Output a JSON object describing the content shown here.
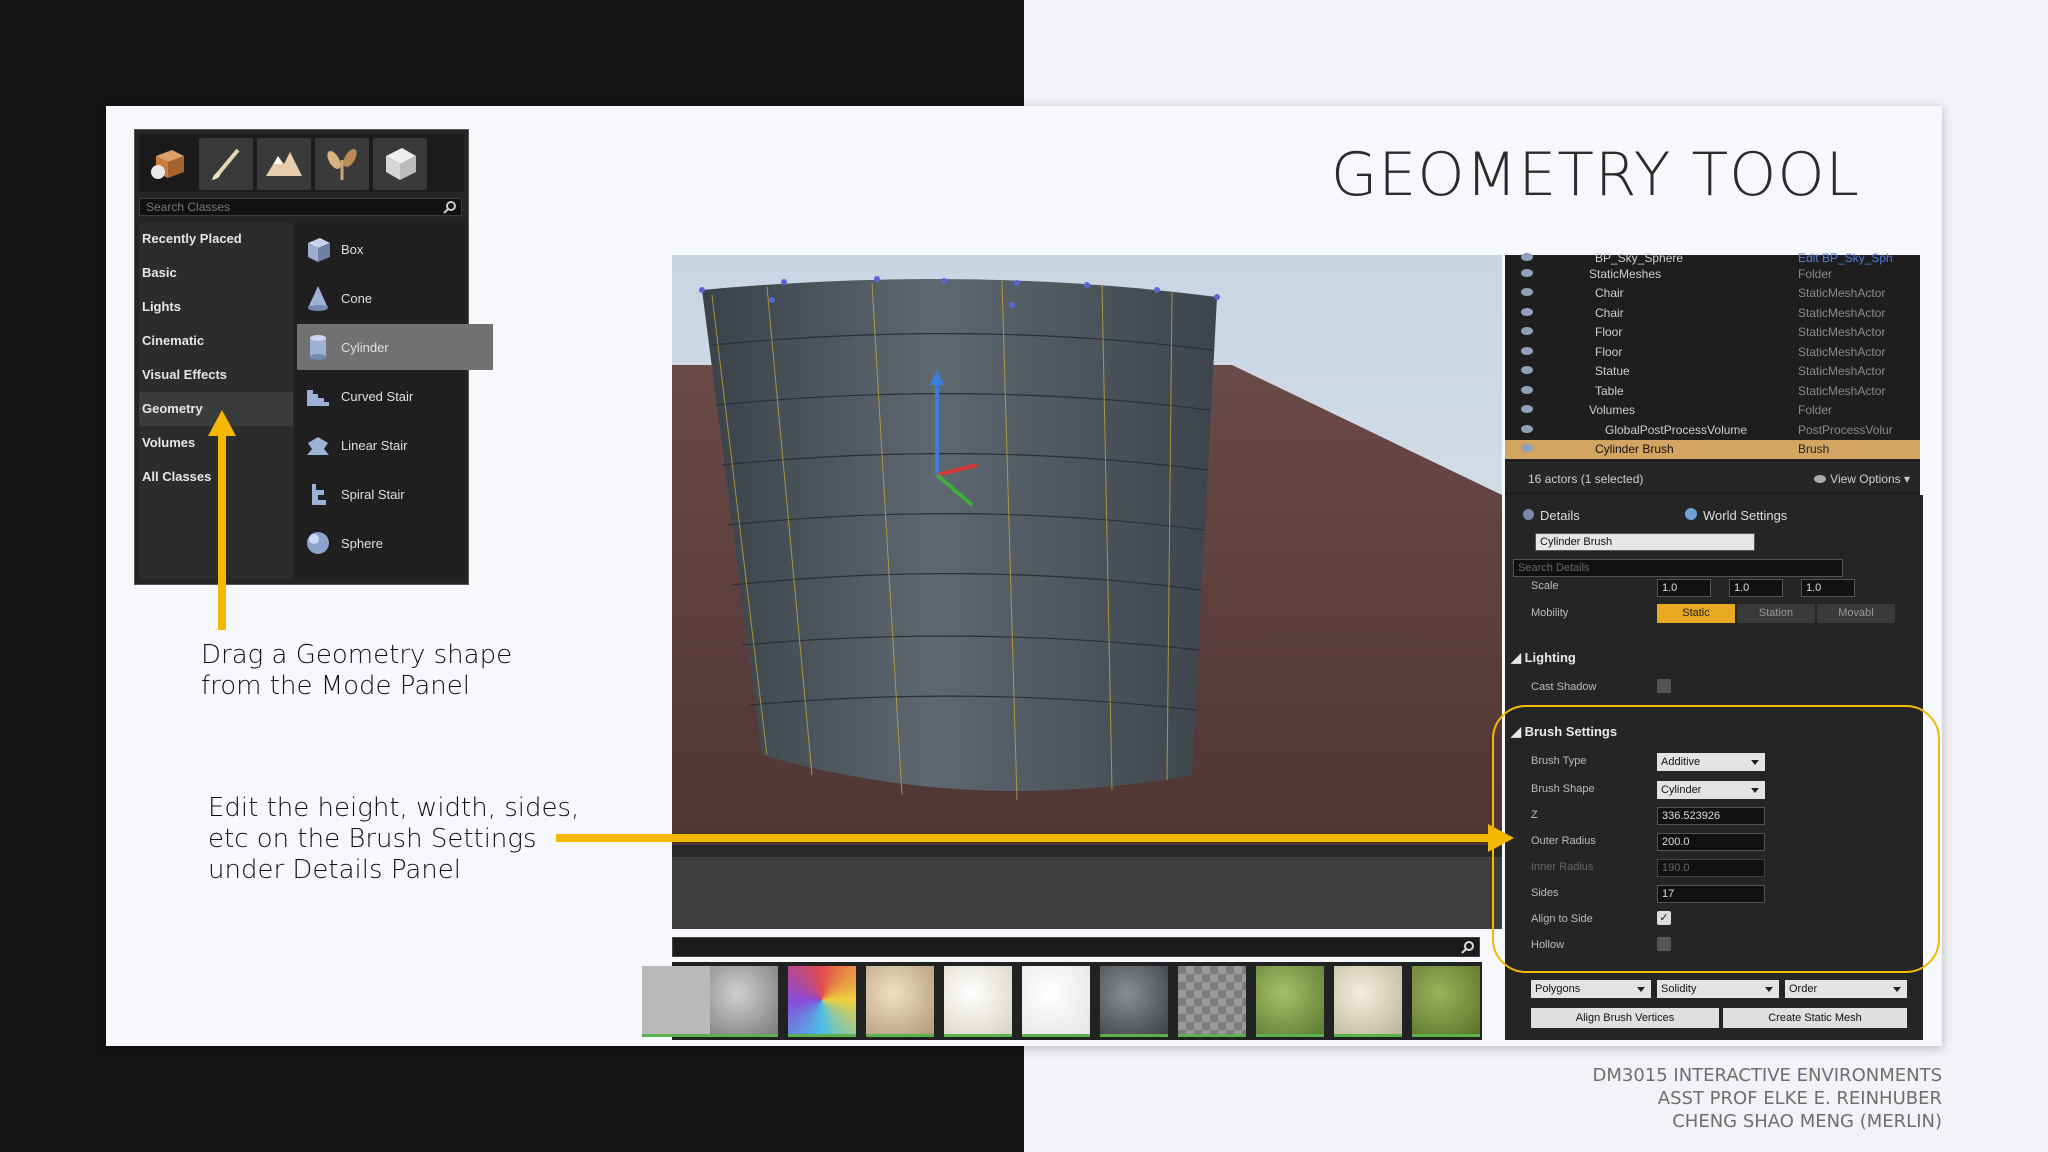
{
  "slide": {
    "title": "GEOMETRY TOOL",
    "callout_drag": [
      "Drag a Geometry shape",
      "from the Mode Panel"
    ],
    "callout_edit": [
      "Edit the height, width, sides,",
      "etc on the Brush Settings",
      "under Details Panel"
    ],
    "footer": [
      "DM3015 INTERACTIVE ENVIRONMENTS",
      "ASST PROF ELKE E. REINHUBER",
      "CHENG SHAO MENG (MERLIN)"
    ],
    "accent_color": "#f5b800"
  },
  "mode_panel": {
    "search_placeholder": "Search Classes",
    "tabs": [
      "place-icon",
      "paint-icon",
      "landscape-icon",
      "foliage-icon",
      "geometry-edit-icon"
    ],
    "categories": [
      "Recently Placed",
      "Basic",
      "Lights",
      "Cinematic",
      "Visual Effects",
      "Geometry",
      "Volumes",
      "All Classes"
    ],
    "active_category": "Geometry",
    "items": [
      "Box",
      "Cone",
      "Cylinder",
      "Curved Stair",
      "Linear Stair",
      "Spiral Stair",
      "Sphere"
    ],
    "selected_item": "Cylinder"
  },
  "outliner": {
    "top_partial": {
      "name": "BP_Sky_Sphere",
      "type": "Edit BP_Sky_Sph"
    },
    "rows": [
      {
        "name": "StaticMeshes",
        "type": "Folder"
      },
      {
        "name": "Chair",
        "type": "StaticMeshActor"
      },
      {
        "name": "Chair",
        "type": "StaticMeshActor"
      },
      {
        "name": "Floor",
        "type": "StaticMeshActor"
      },
      {
        "name": "Floor",
        "type": "StaticMeshActor"
      },
      {
        "name": "Statue",
        "type": "StaticMeshActor"
      },
      {
        "name": "Table",
        "type": "StaticMeshActor"
      },
      {
        "name": "Volumes",
        "type": "Folder"
      },
      {
        "name": "GlobalPostProcessVolume",
        "type": "PostProcessVolur"
      },
      {
        "name": "Cylinder Brush",
        "type": "Brush"
      }
    ],
    "status": "16 actors (1 selected)",
    "view_options": "View Options"
  },
  "details": {
    "tab_details": "Details",
    "tab_world": "World Settings",
    "actor_name": "Cylinder Brush",
    "search_placeholder": "Search Details",
    "scale_label": "Scale",
    "scale": {
      "x": "1.0",
      "y": "1.0",
      "z": "1.0"
    },
    "mobility_label": "Mobility",
    "mobility_options": [
      "Static",
      "Station",
      "Movabl"
    ],
    "lighting_section": "Lighting",
    "cast_shadow": "Cast Shadow",
    "brush_section": "Brush Settings",
    "brush_type_label": "Brush Type",
    "brush_type": "Additive",
    "brush_shape_label": "Brush Shape",
    "brush_shape": "Cylinder",
    "z_label": "Z",
    "z": "336.523926",
    "outer_radius_label": "Outer Radius",
    "outer_radius": "200.0",
    "inner_radius_label": "Inner Radius",
    "inner_radius": "190.0",
    "sides_label": "Sides",
    "sides": "17",
    "align_label": "Align to Side",
    "align_checked": true,
    "hollow_label": "Hollow",
    "hollow_checked": false,
    "polygons": "Polygons",
    "solidity": "Solidity",
    "order": "Order",
    "align_vertices_btn": "Align Brush Vertices",
    "create_mesh_btn": "Create Static Mesh"
  }
}
